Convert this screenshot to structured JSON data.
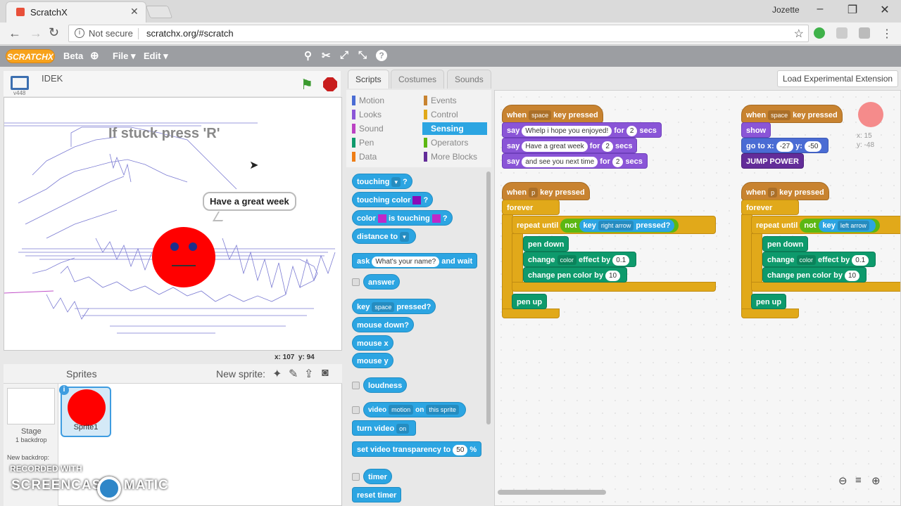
{
  "browser": {
    "tab_title": "ScratchX",
    "user": "Jozette",
    "security": "Not secure",
    "url": "scratchx.org/#scratch"
  },
  "menu": {
    "logo": "SCRATCHX",
    "beta": "Beta",
    "file": "File ▾",
    "edit": "Edit ▾"
  },
  "stage": {
    "title": "IDEK",
    "version": "v448",
    "stuck_text": "If stuck press 'R'",
    "speech": "Have a great week",
    "coord_x": "x: 107",
    "coord_y": "y: 94"
  },
  "sprites": {
    "header": "Sprites",
    "new_sprite": "New sprite:",
    "stage_label": "Stage",
    "backdrops": "1 backdrop",
    "new_backdrop": "New backdrop:",
    "sprite1": "Sprite1"
  },
  "watermark": {
    "line1": "RECORDED WITH",
    "line2a": "SCREENCAST",
    "line2b": "MATIC"
  },
  "tabs": {
    "scripts": "Scripts",
    "costumes": "Costumes",
    "sounds": "Sounds",
    "load_ext": "Load Experimental Extension"
  },
  "categories": [
    {
      "label": "Motion",
      "color": "#4a6cd4"
    },
    {
      "label": "Events",
      "color": "#c88330"
    },
    {
      "label": "Looks",
      "color": "#8a55d7"
    },
    {
      "label": "Control",
      "color": "#e1a91a"
    },
    {
      "label": "Sound",
      "color": "#bb42c3"
    },
    {
      "label": "Sensing",
      "color": "#2ca5e2"
    },
    {
      "label": "Pen",
      "color": "#0e9a6c"
    },
    {
      "label": "Operators",
      "color": "#5cb712"
    },
    {
      "label": "Data",
      "color": "#ee7d16"
    },
    {
      "label": "More Blocks",
      "color": "#632d99"
    }
  ],
  "palette": {
    "touching": "touching",
    "touching_color": "touching color",
    "color": "color",
    "is_touching": "is touching",
    "distance_to": "distance to",
    "ask": "ask",
    "ask_default": "What's your name?",
    "and_wait": "and wait",
    "answer": "answer",
    "key": "key",
    "space": "space",
    "pressed": "pressed?",
    "mouse_down": "mouse down?",
    "mouse_x": "mouse x",
    "mouse_y": "mouse y",
    "loudness": "loudness",
    "video": "video",
    "motion": "motion",
    "on": "on",
    "this_sprite": "this sprite",
    "turn_video": "turn video",
    "on_opt": "on",
    "set_video_transparency": "set video transparency to",
    "transp_val": "50",
    "percent": "%",
    "timer": "timer",
    "reset_timer": "reset timer"
  },
  "scripts": {
    "when": "when",
    "key_pressed": "key pressed",
    "space": "space",
    "p": "p",
    "say": "say",
    "for": "for",
    "secs": "secs",
    "msg1": "Whelp i hope you enjoyed!",
    "msg2": "Have a great week",
    "msg3": "and see you next time",
    "two": "2",
    "show": "show",
    "go_to_x": "go to x:",
    "x_val": "-27",
    "y_label": "y:",
    "y_val": "-50",
    "jump_power": "JUMP POWER",
    "forever": "forever",
    "repeat_until": "repeat until",
    "not": "not",
    "key": "key",
    "right_arrow": "right arrow",
    "left_arrow": "left arrow",
    "pressed": "pressed?",
    "pen_down": "pen down",
    "change": "change",
    "color_opt": "color",
    "effect_by": "effect by",
    "effect_val": "0.1",
    "change_pen_color": "change pen color by",
    "pen_val": "10",
    "pen_up": "pen up",
    "sprite_x": "x: 15",
    "sprite_y": "y: -48"
  }
}
